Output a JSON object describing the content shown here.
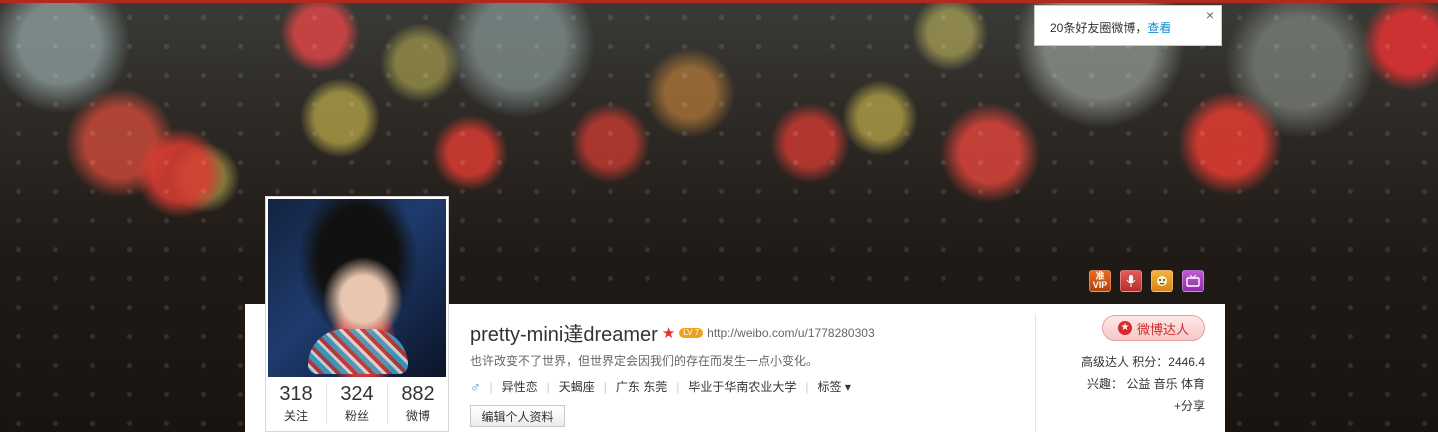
{
  "notification": {
    "text": "20条好友圈微博，",
    "link": "查看",
    "close": "×"
  },
  "badges": [
    {
      "icon": "vip-badge-icon",
      "text": "准VIP"
    },
    {
      "icon": "microphone-badge-icon",
      "text": ""
    },
    {
      "icon": "tiger-badge-icon",
      "text": ""
    },
    {
      "icon": "tv-badge-icon",
      "text": ""
    }
  ],
  "profile": {
    "name": "pretty-mini達dreamer",
    "level_badge": "LV 7",
    "url": "http://weibo.com/u/1778280303",
    "bio": "也许改变不了世界，但世界定会因我们的存在而发生一点小变化。",
    "gender_symbol": "♂",
    "tags": [
      "异性恋",
      "天蝎座",
      "广东 东莞",
      "毕业于华南农业大学"
    ],
    "tags_menu": "标签 ▾",
    "edit_button": "编辑个人资料"
  },
  "stats": [
    {
      "num": "318",
      "label": "关注"
    },
    {
      "num": "324",
      "label": "粉丝"
    },
    {
      "num": "882",
      "label": "微博"
    }
  ],
  "sidebar": {
    "expert_button": "微博达人",
    "level_line": "高级达人   积分：2446.4",
    "interests": "兴趣：  公益 音乐 体育",
    "share": "+分享"
  }
}
